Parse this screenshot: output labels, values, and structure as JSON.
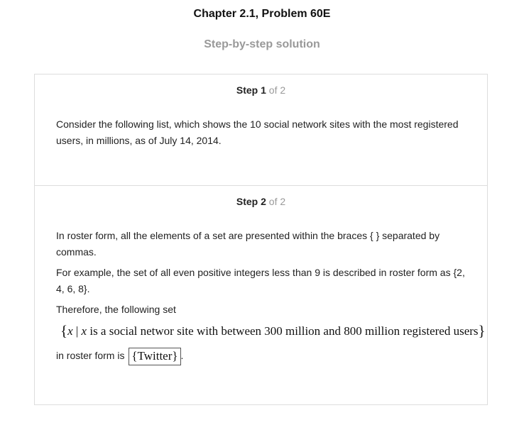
{
  "header": {
    "title": "Chapter 2.1, Problem 60E",
    "subtitle": "Step-by-step solution"
  },
  "steps": [
    {
      "label": "Step",
      "number": "1",
      "of_text": "of 2",
      "paragraphs": [
        "Consider the following list, which shows the 10 social network sites with the most registered users, in millions, as of July 14, 2014."
      ]
    },
    {
      "label": "Step",
      "number": "2",
      "of_text": "of 2",
      "paragraphs": [
        "In roster form, all the elements of a set are presented within the braces { } separated by commas.",
        "For example, the set of all even positive integers less than 9 is described in roster form as {2, 4, 6, 8}.",
        "Therefore, the following set"
      ],
      "set_builder": {
        "open_brace": "{",
        "variable": "x",
        "bar": " | ",
        "variable_again": "x",
        "condition": " is a social networ site with between 300 million and 800 million registered users",
        "close_brace": "}"
      },
      "answer": {
        "prefix": "in roster form is ",
        "value": "{Twitter}",
        "suffix": "."
      }
    }
  ]
}
